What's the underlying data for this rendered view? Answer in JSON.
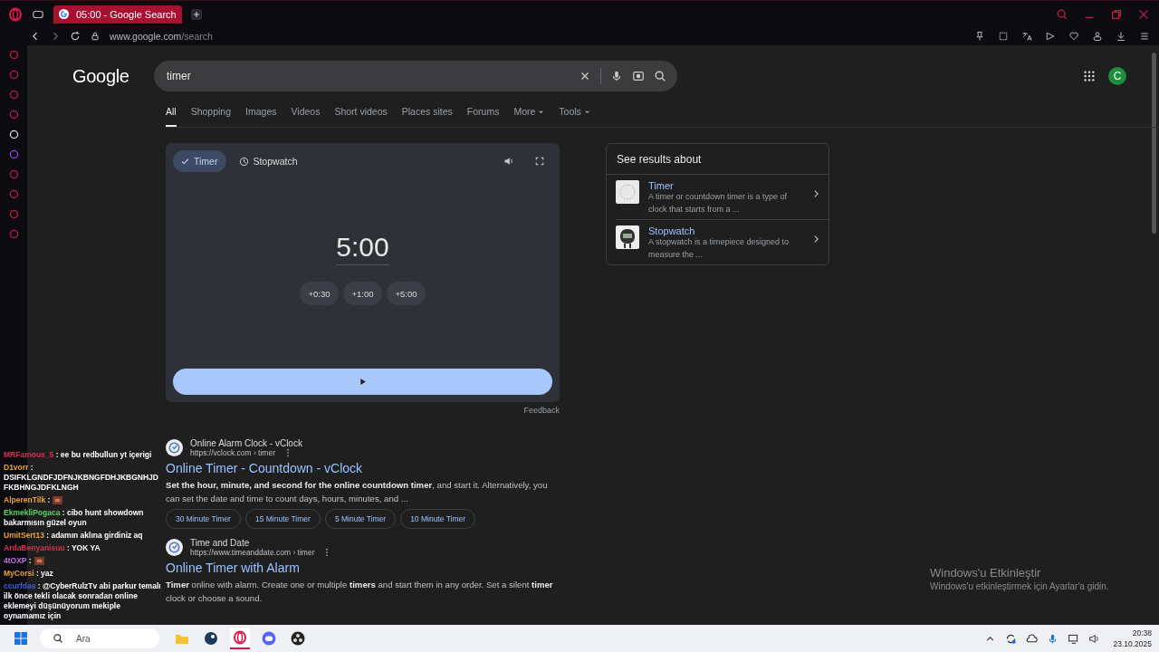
{
  "browser": {
    "tab_title": "05:00 - Google Search",
    "url_host": "www.google.com",
    "url_path": "/search"
  },
  "search": {
    "logo": "Google",
    "query": "timer",
    "avatar_letter": "C"
  },
  "nav_tabs": [
    {
      "label": "All",
      "selected": true,
      "kind": "plain"
    },
    {
      "label": "Shopping",
      "selected": false,
      "kind": "plain"
    },
    {
      "label": "Images",
      "selected": false,
      "kind": "plain"
    },
    {
      "label": "Videos",
      "selected": false,
      "kind": "plain"
    },
    {
      "label": "Short videos",
      "selected": false,
      "kind": "plain"
    },
    {
      "label": "Places sites",
      "selected": false,
      "kind": "plain"
    },
    {
      "label": "Forums",
      "selected": false,
      "kind": "plain"
    },
    {
      "label": "More",
      "selected": false,
      "kind": "menu"
    },
    {
      "label": "Tools",
      "selected": false,
      "kind": "menu"
    }
  ],
  "timer_widget": {
    "modes": [
      {
        "label": "Timer",
        "selected": true,
        "kind": "timer"
      },
      {
        "label": "Stopwatch",
        "selected": false,
        "kind": "stopwatch"
      }
    ],
    "time": "5:00",
    "increments": [
      "+0:30",
      "+1:00",
      "+5:00"
    ],
    "feedback": "Feedback"
  },
  "results": [
    {
      "site": "Online Alarm Clock - vClock",
      "url": "https://vclock.com › timer",
      "title": "Online Timer - Countdown - vClock",
      "snippet": "**Set the hour, minute, and second for the online countdown timer**, and start it. Alternatively, you can set the date and time to count days, hours, minutes, and ...",
      "links": [
        "30 Minute Timer",
        "15 Minute Timer",
        "5 Minute Timer",
        "10 Minute Timer"
      ]
    },
    {
      "site": "Time and Date",
      "url": "https://www.timeanddate.com › timer",
      "title": "Online Timer with Alarm",
      "snippet": "**Timer** online with alarm. Create one or multiple **timers** and start them in any order. Set a silent **timer** clock or choose a sound."
    }
  ],
  "knowledge": {
    "title": "See results about",
    "items": [
      {
        "name": "Timer",
        "description": "A timer or countdown timer is a type of clock that starts from a ...",
        "kind": "timer"
      },
      {
        "name": "Stopwatch",
        "description": "A stopwatch is a timepiece designed to measure the ...",
        "kind": "stopwatch"
      }
    ]
  },
  "chat": [
    {
      "user": "MRFamous_5",
      "color": "#d63150",
      "kind": "text",
      "message": ": ee bu redbullun yt içerigi"
    },
    {
      "user": "D1vorr",
      "color": "#e8a03a",
      "kind": "text",
      "message": ": DSIFKLGNDFJDFNJKBNGFDHJKBGNHJDFKBHNGJDFKLNGH"
    },
    {
      "user": "AlperenTilk",
      "color": "#e8a03a",
      "kind": "emote",
      "message": ":"
    },
    {
      "user": "EkmekliPogaca",
      "color": "#5ed05e",
      "kind": "text",
      "message": ": cibo hunt showdown bakarmısın güzel oyun"
    },
    {
      "user": "UmitSert13",
      "color": "#e8a03a",
      "kind": "text",
      "message": ": adamın aklına girdiniz aq"
    },
    {
      "user": "ArdaBenyanisuu",
      "color": "#d63150",
      "kind": "text",
      "message": ": YOK YA"
    },
    {
      "user": "4tOXP",
      "color": "#c070e0",
      "kind": "emote",
      "message": ":"
    },
    {
      "user": "MyCorsi",
      "color": "#e8a03a",
      "kind": "text",
      "message": ": yaz"
    },
    {
      "user": "ccurfdas",
      "color": "#3a62d8",
      "kind": "text",
      "message": ": @CyberRulzTv abi parkur temalı ilk önce tekli olacak sonradan online eklemeyi düşünüyorum mekiple oynamamız için"
    }
  ],
  "activation": {
    "title": "Windows'u Etkinleştir",
    "message": "Windows'u etkinleştirmek için Ayarlar'a gidin."
  },
  "taskbar": {
    "search_placeholder": "Ara",
    "time": "20:38",
    "date": "23.10.2025"
  }
}
